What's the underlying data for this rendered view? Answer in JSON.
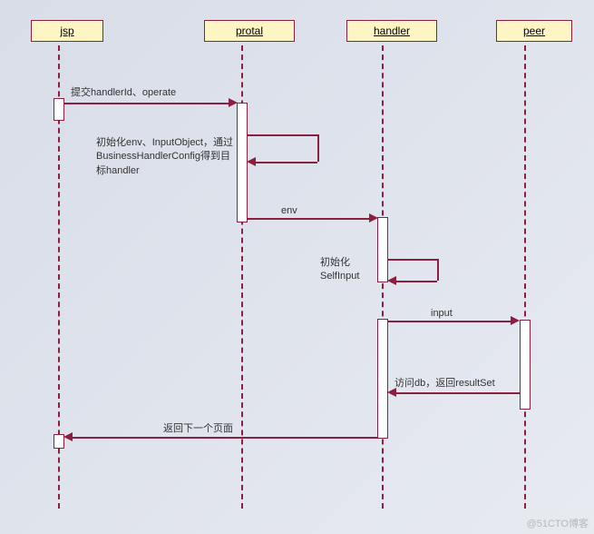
{
  "participants": {
    "p1": "jsp",
    "p2": "protal",
    "p3": "handler",
    "p4": "peer"
  },
  "messages": {
    "m1": "提交handlerId、operate",
    "m2": "初始化env、InputObject，通过BusinessHandlerConfig得到目标handler",
    "m3": "env",
    "m4": "初始化\nSelfInput",
    "m5": "input",
    "m6": "访问db，返回resultSet",
    "m7": "返回下一个页面"
  },
  "watermark": "@51CTO博客",
  "chart_data": {
    "type": "sequence-diagram",
    "participants": [
      "jsp",
      "protal",
      "handler",
      "peer"
    ],
    "messages": [
      {
        "from": "jsp",
        "to": "protal",
        "label": "提交handlerId、operate",
        "kind": "sync"
      },
      {
        "from": "protal",
        "to": "protal",
        "label": "初始化env、InputObject，通过BusinessHandlerConfig得到目标handler",
        "kind": "self"
      },
      {
        "from": "protal",
        "to": "handler",
        "label": "env",
        "kind": "sync"
      },
      {
        "from": "handler",
        "to": "handler",
        "label": "初始化SelfInput",
        "kind": "self"
      },
      {
        "from": "handler",
        "to": "peer",
        "label": "input",
        "kind": "sync"
      },
      {
        "from": "peer",
        "to": "handler",
        "label": "访问db，返回resultSet",
        "kind": "return"
      },
      {
        "from": "handler",
        "to": "jsp",
        "label": "返回下一个页面",
        "kind": "return"
      }
    ]
  }
}
